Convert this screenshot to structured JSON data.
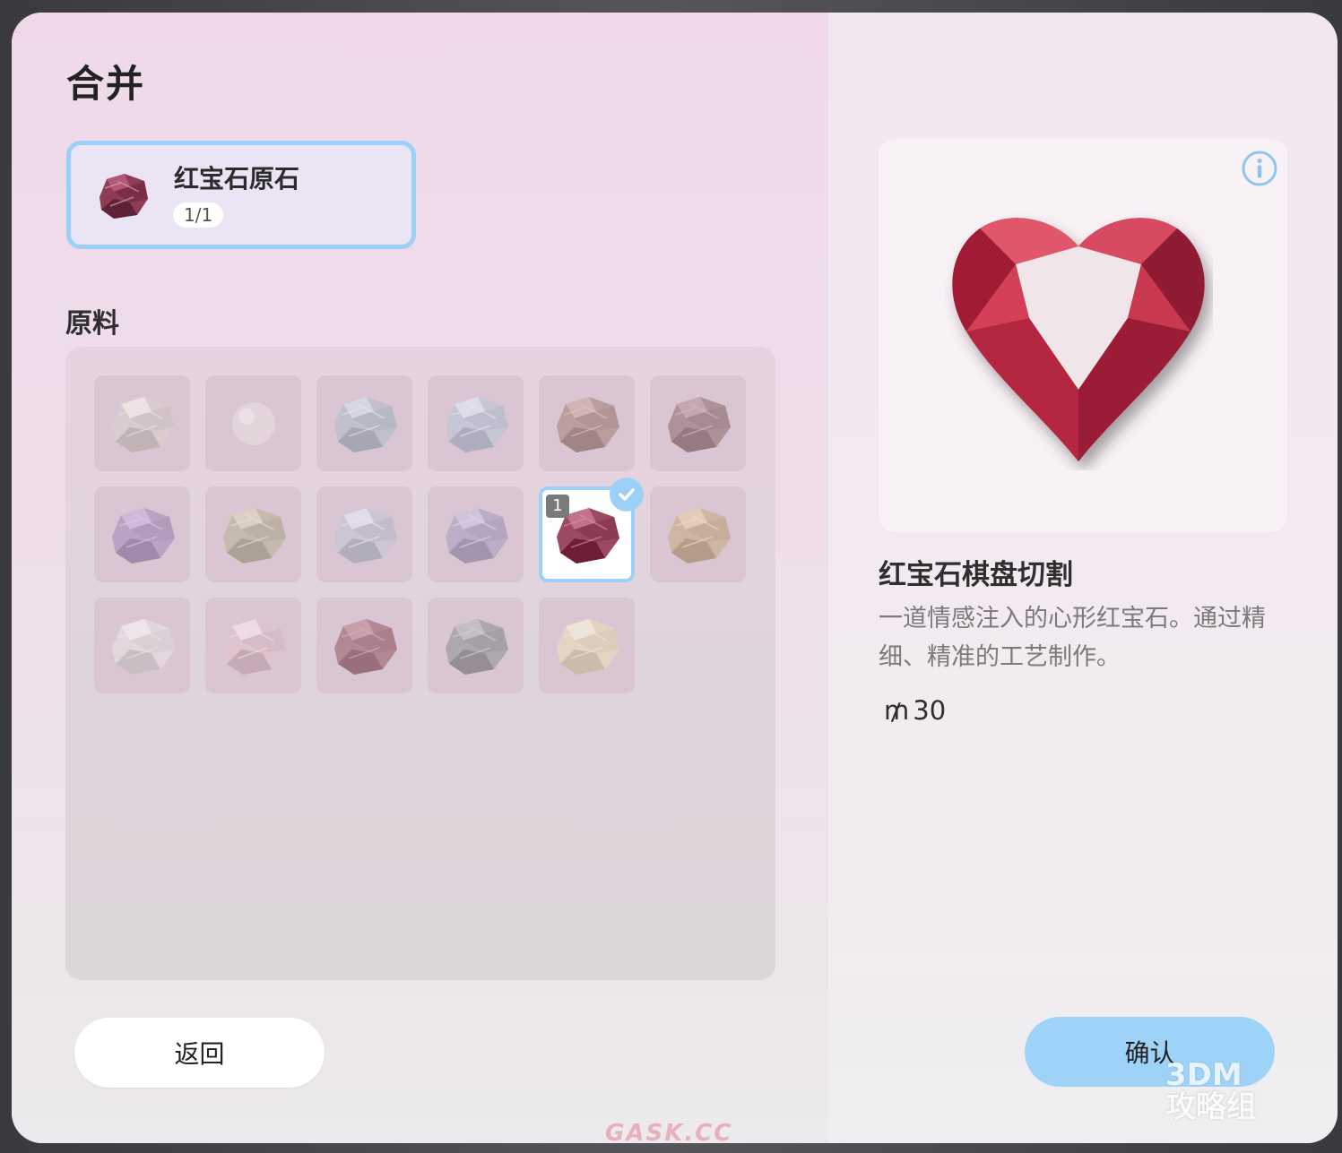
{
  "header": {
    "title": "合并"
  },
  "target": {
    "name": "红宝石原石",
    "count": "1/1"
  },
  "materials": {
    "label": "原料",
    "items": [
      {
        "color": "#d9d0cc",
        "shape": "rock"
      },
      {
        "color": "#ece1e4",
        "shape": "pearl"
      },
      {
        "color": "#a9bcc8",
        "shape": "rock"
      },
      {
        "color": "#b7c7dc",
        "shape": "rock"
      },
      {
        "color": "#a07d75",
        "shape": "rock"
      },
      {
        "color": "#8a6a6c",
        "shape": "rock"
      },
      {
        "color": "#9d87b6",
        "shape": "rock"
      },
      {
        "color": "#b6b092",
        "shape": "rock"
      },
      {
        "color": "#c0c6d6",
        "shape": "rock"
      },
      {
        "color": "#a59bbe",
        "shape": "rock"
      },
      {
        "color": "#9c4a62",
        "shape": "rock",
        "selected": true,
        "qty": "1"
      },
      {
        "color": "#c5a980",
        "shape": "rock"
      },
      {
        "color": "#e8e6e6",
        "shape": "rock"
      },
      {
        "color": "#e2c3cc",
        "shape": "rock"
      },
      {
        "color": "#925664",
        "shape": "rock"
      },
      {
        "color": "#8a8f92",
        "shape": "rock"
      },
      {
        "color": "#ece0b8",
        "shape": "rock"
      }
    ]
  },
  "buttons": {
    "back": "返回",
    "confirm": "确认"
  },
  "item": {
    "name": "红宝石棋盘切割",
    "desc": "一道情感注入的心形红宝石。通过精细、精准的工艺制作。",
    "currency_symbol": "₥",
    "price": "30"
  },
  "icons": {
    "info": "info-icon",
    "check": "check-icon"
  },
  "colors": {
    "accent": "#9dd0f6",
    "ruby": "#c2384c"
  },
  "watermarks": {
    "site": "GASK.CC",
    "brand_line1": "3DM",
    "brand_line2": "攻略组"
  }
}
